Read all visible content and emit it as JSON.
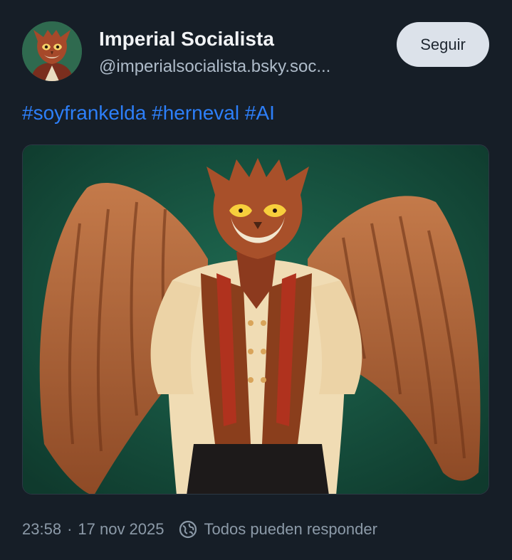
{
  "author": {
    "display_name": "Imperial Socialista",
    "handle": "@imperialsocialista.bsky.soc..."
  },
  "follow_button": {
    "label": "Seguir"
  },
  "post": {
    "hashtags": [
      "#soyfrankelda",
      "#herneval",
      "#AI"
    ],
    "image_icon": "winged-owl-character-illustration"
  },
  "meta": {
    "time": "23:58",
    "separator": "·",
    "date": "17 nov 2025",
    "reply_setting": "Todos pueden responder",
    "reply_icon": "globe-icon"
  },
  "colors": {
    "background": "#161e27",
    "hashtag": "#2d7ff9",
    "follow_button_bg": "#dce2ea",
    "muted_text": "#8c9aa8"
  }
}
